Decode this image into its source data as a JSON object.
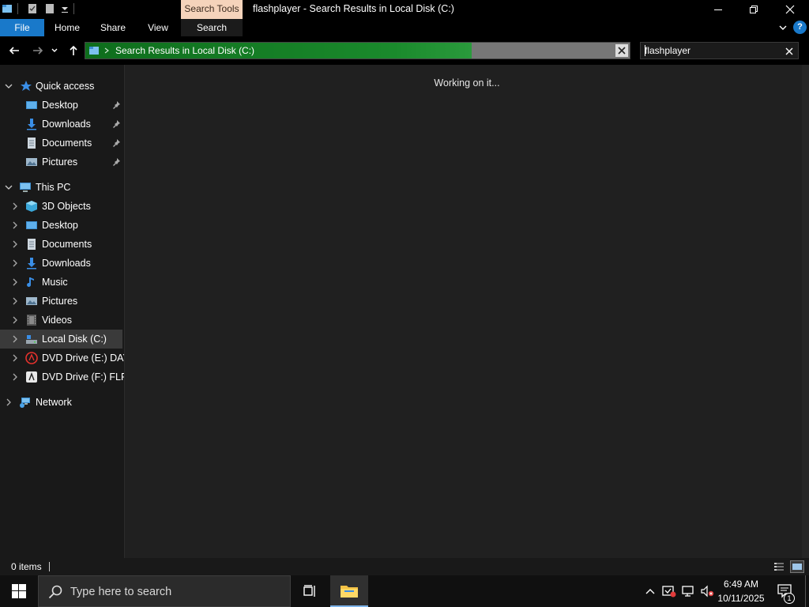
{
  "window": {
    "title": "flashplayer - Search Results in Local Disk (C:)",
    "context_tab": "Search Tools"
  },
  "ribbon": {
    "tabs": [
      {
        "label": "File"
      },
      {
        "label": "Home"
      },
      {
        "label": "Share"
      },
      {
        "label": "View"
      },
      {
        "label": "Search"
      }
    ]
  },
  "address": {
    "path": "Search Results in Local Disk (C:)",
    "progress_fraction": 0.71
  },
  "search": {
    "value": "flashplayer"
  },
  "nav": {
    "quick_access": {
      "label": "Quick access",
      "items": [
        {
          "label": "Desktop"
        },
        {
          "label": "Downloads"
        },
        {
          "label": "Documents"
        },
        {
          "label": "Pictures"
        }
      ]
    },
    "this_pc": {
      "label": "This PC",
      "items": [
        {
          "label": "3D Objects"
        },
        {
          "label": "Desktop"
        },
        {
          "label": "Documents"
        },
        {
          "label": "Downloads"
        },
        {
          "label": "Music"
        },
        {
          "label": "Pictures"
        },
        {
          "label": "Videos"
        },
        {
          "label": "Local Disk (C:)"
        },
        {
          "label": "DVD Drive (E:) DAY_"
        },
        {
          "label": "DVD Drive (F:) FLPR"
        }
      ]
    },
    "network": {
      "label": "Network"
    }
  },
  "content": {
    "status_message": "Working on it..."
  },
  "statusbar": {
    "item_count": "0 items"
  },
  "taskbar": {
    "search_placeholder": "Type here to search",
    "time": "6:49 AM",
    "date": "10/11/2025",
    "notification_count": "1"
  },
  "colors": {
    "file_tab": "#1979ca",
    "context_tab": "#f5d3bb",
    "progress": "#1a8a2c",
    "selected": "#3a3a3a"
  }
}
